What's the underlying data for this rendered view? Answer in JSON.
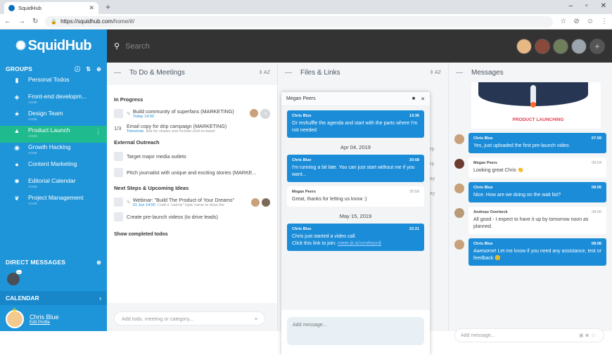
{
  "browser": {
    "tab_title": "SquidHub",
    "url_host": "https://squidhub.com",
    "url_path": "/home/#/"
  },
  "search": {
    "placeholder": "Search"
  },
  "sidebar": {
    "logo": "SquidHub",
    "groups_title": "GROUPS",
    "groups": [
      {
        "label": "Personal Todos",
        "sub": ""
      },
      {
        "label": "Front-end developm...",
        "sub": "ACME"
      },
      {
        "label": "Design Team",
        "sub": "ACME"
      },
      {
        "label": "Product Launch",
        "sub": "ACME",
        "active": true
      },
      {
        "label": "Growth Hacking",
        "sub": "ACME"
      },
      {
        "label": "Content Marketing",
        "sub": ""
      },
      {
        "label": "Editorial Calendar",
        "sub": "ACME"
      },
      {
        "label": "Project Management",
        "sub": "ACME"
      }
    ],
    "direct_messages_title": "DIRECT MESSAGES",
    "calendar_title": "CALENDAR",
    "user_name": "Chris Blue",
    "edit_profile": "Edit Profile"
  },
  "todo": {
    "title": "To Do & Meetings",
    "sort": "AZ",
    "sections": [
      {
        "name": "In Progress",
        "items": [
          {
            "text": "Build community of superfans (MARKETING)",
            "sub": "Today 14:00",
            "sub_note": "",
            "count": "+2"
          },
          {
            "text": "Email copy for drip campaign (MARKETING)",
            "sub": "Tomorrow",
            "sub_note": "Ask for shares and include click-to-tweet",
            "progress": "1/3"
          }
        ]
      },
      {
        "name": "External Outreach",
        "items": [
          {
            "text": "Target major media outlets"
          },
          {
            "text": "Pitch journalist with unique and exciting stories (MARKE..."
          }
        ]
      },
      {
        "name": "Next Steps & Upcoming Ideas",
        "items": [
          {
            "text": "Webinar: \"Build The Product of Your Dreams\"",
            "sub": "01 Jun 14:00",
            "sub_note": "Craft a \"catchy\" topic name to draw the"
          },
          {
            "text": "Create pre-launch videos (to drive leads)"
          }
        ]
      }
    ],
    "show_completed": "Show completed todos",
    "add_placeholder": "Add todo, meeting or category..."
  },
  "files": {
    "title": "Files & Links",
    "sort": "AZ",
    "dates": [
      "Sep",
      "Sep",
      "May",
      "May"
    ]
  },
  "chat": {
    "with": "Megan Peers",
    "messages": [
      {
        "from": "Chris Blue",
        "time": "13:36",
        "text": "Or reshuffle the agenda and start with the parts where I'm not needed",
        "style": "blue"
      },
      {
        "date": "Apr 04, 2019"
      },
      {
        "from": "Chris Blue",
        "time": "20:58",
        "text": "I'm running a bit late. You can just start without me if you want...",
        "style": "blue"
      },
      {
        "from": "Megan Peers",
        "time": "20:58",
        "text": "Great, thanks for letting us know :)",
        "style": "white"
      },
      {
        "date": "May 15, 2019"
      },
      {
        "from": "Chris Blue",
        "time": "22:21",
        "text": "Chris just started a video call.",
        "text2": "Click this link to join:",
        "link": "meet.jit.si/rzmfejonfj",
        "style": "blue"
      }
    ],
    "input_placeholder": "Add message..."
  },
  "messages": {
    "title": "Messages",
    "banner_text": "PRODUCT LAUNCHING",
    "items": [
      {
        "from": "Chris Blue",
        "time": "07:59",
        "text": "Yes, just uploaded the first pre-launch video.",
        "style": "blue"
      },
      {
        "from": "Megan Peers",
        "time": "08:04",
        "text": "Looking great Chris 👏",
        "style": "white"
      },
      {
        "from": "Chris Blue",
        "time": "08:05",
        "text": "Nice. How are we doing on the wait list?",
        "style": "blue"
      },
      {
        "from": "Andreas Overbeck",
        "time": "08:06",
        "text": "All good - I expect to have it up by tomorrow noon as planned.",
        "style": "white"
      },
      {
        "from": "Chris Blue",
        "time": "08:08",
        "text": "Awesome! Let me know if you need any assistance, test or feedback 😊",
        "style": "blue"
      }
    ],
    "input_placeholder": "Add message..."
  }
}
